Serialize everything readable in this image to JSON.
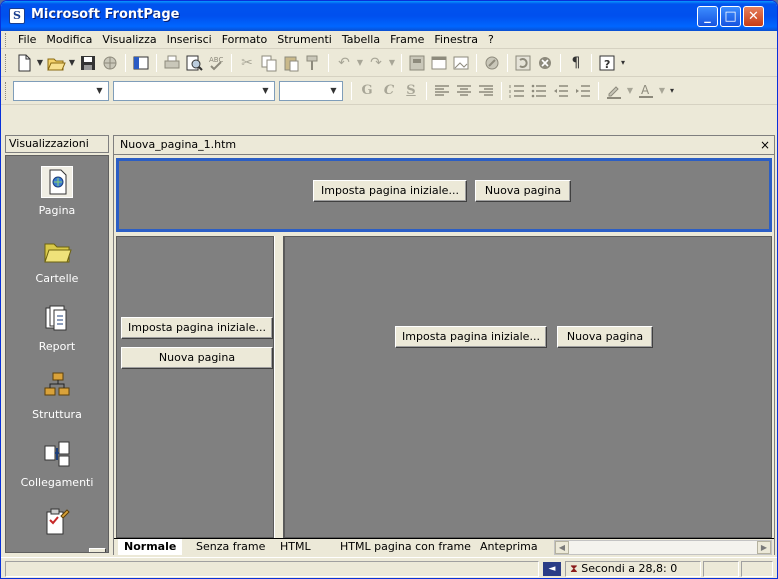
{
  "window": {
    "title": "Microsoft FrontPage",
    "app_icon_glyph": "S",
    "controls": {
      "minimize": "_",
      "maximize": "□",
      "close": "✕"
    }
  },
  "menu": {
    "items": [
      "File",
      "Modifica",
      "Visualizza",
      "Inserisci",
      "Formato",
      "Strumenti",
      "Tabella",
      "Frame",
      "Finestra",
      "?"
    ]
  },
  "toolbar_standard": {
    "icons": [
      "new-page-icon",
      "open-icon",
      "save-icon",
      "publish-icon",
      "folder-list-icon",
      "print-icon",
      "print-preview-icon",
      "spelling-icon",
      "cut-icon",
      "copy-icon",
      "paste-icon",
      "format-painter-icon",
      "undo-icon",
      "redo-icon",
      "web-component-icon",
      "insert-table-icon",
      "insert-picture-icon",
      "hyperlink-icon",
      "refresh-icon",
      "stop-icon",
      "show-all-icon",
      "help-icon"
    ],
    "show_all_glyph": "¶"
  },
  "toolbar_format": {
    "style_value": "",
    "font_value": "",
    "size_value": "",
    "bold_label": "G",
    "italic_label": "C",
    "underline_label": "S"
  },
  "views": {
    "header": "Visualizzazioni",
    "items": [
      {
        "label": "Pagina",
        "icon": "page-view-icon",
        "selected": true
      },
      {
        "label": "Cartelle",
        "icon": "folders-view-icon",
        "selected": false
      },
      {
        "label": "Report",
        "icon": "reports-view-icon",
        "selected": false
      },
      {
        "label": "Struttura",
        "icon": "navigation-view-icon",
        "selected": false
      },
      {
        "label": "Collegamenti",
        "icon": "hyperlinks-view-icon",
        "selected": false
      },
      {
        "label": "",
        "icon": "tasks-view-icon",
        "selected": false
      }
    ]
  },
  "document": {
    "tab_title": "Nuova_pagina_1.htm",
    "close_glyph": "×",
    "frames": {
      "top": {
        "set_initial_label": "Imposta pagina iniziale...",
        "new_page_label": "Nuova pagina"
      },
      "left": {
        "set_initial_label": "Imposta pagina iniziale...",
        "new_page_label": "Nuova pagina"
      },
      "main": {
        "set_initial_label": "Imposta pagina iniziale...",
        "new_page_label": "Nuova pagina"
      }
    }
  },
  "view_tabs": [
    "Normale",
    "Senza frame",
    "HTML",
    "HTML pagina con frame",
    "Anteprima"
  ],
  "status": {
    "download_time": "Secondi a 28,8: 0"
  },
  "colors": {
    "titlebar_blue": "#0053ee",
    "selected_frame_border": "#2b5ec5",
    "frame_fill": "#808080",
    "chrome": "#ece9d8"
  }
}
